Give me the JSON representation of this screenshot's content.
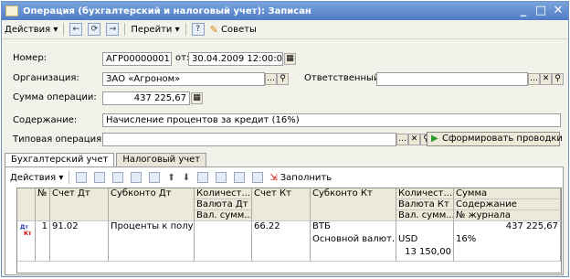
{
  "window": {
    "title": "Операция (бухгалтерский и налоговый учет): Записан"
  },
  "toolbar": {
    "actions": "Действия",
    "goto": "Перейти",
    "help": "?",
    "tips": "Советы"
  },
  "form": {
    "number_label": "Номер:",
    "number_value": "АГР00000001",
    "date_label": "от:",
    "date_value": "30.04.2009 12:00:00",
    "org_label": "Организация:",
    "org_value": "ЗАО «Агроном»",
    "resp_label": "Ответственный:",
    "resp_value": "",
    "sum_label": "Сумма операции:",
    "sum_value": "437 225,67",
    "content_label": "Содержание:",
    "content_value": "Начисление процентов за кредит (16%)",
    "typical_label": "Типовая операция:",
    "typical_value": "",
    "generate_button": "Сформировать проводки"
  },
  "tabs": [
    "Бухгалтерский учет",
    "Налоговый учет"
  ],
  "subtoolbar": {
    "actions": "Действия",
    "fill": "Заполнить"
  },
  "table": {
    "headers": {
      "num": "№",
      "dt": "Счет Дт",
      "subdt": "Субконто Дт",
      "qty_dt": "Количест...",
      "cur_dt": "Валюта Дт",
      "valsum_dt": "Вал. сумм...",
      "kt": "Счет Кт",
      "subkt": "Субконто Кт",
      "qty_kt": "Количест...",
      "cur_kt": "Валюта Кт",
      "valsum_kt": "Вал. сумм...",
      "sum": "Сумма",
      "content": "Содержание",
      "journal": "№ журнала"
    },
    "row": {
      "icon_dt": "Дт",
      "icon_kt": "Кт",
      "num": "1",
      "dt": "91.02",
      "subdt": "Проценты к полу...",
      "kt": "66.22",
      "subkt1": "ВТБ",
      "subkt2": "Основной валют...",
      "cur_kt": "USD",
      "valsum_kt": "13 150,00",
      "sum": "437 225,67",
      "content": "16%"
    }
  },
  "icons": [
    "document-icon",
    "minimize-icon",
    "maximize-icon",
    "close-icon",
    "back-icon",
    "refresh-icon",
    "forward-icon",
    "tips-icon",
    "calculator-icon",
    "search-icon",
    "clear-icon",
    "select-icon",
    "play-icon",
    "add-row-icon",
    "copy-row-icon",
    "edit-row-icon",
    "delete-row-icon",
    "end-edit-icon",
    "move-up-icon",
    "move-down-icon",
    "sort-asc-icon",
    "sort-desc-icon",
    "filter-icon",
    "list-icon",
    "fill-icon",
    "entry-icon"
  ],
  "colors": {
    "title_bar": "#4f7cc6",
    "accent_green": "#2a9a2a",
    "debit_red": "#c80000",
    "credit_blue": "#2040b0"
  }
}
